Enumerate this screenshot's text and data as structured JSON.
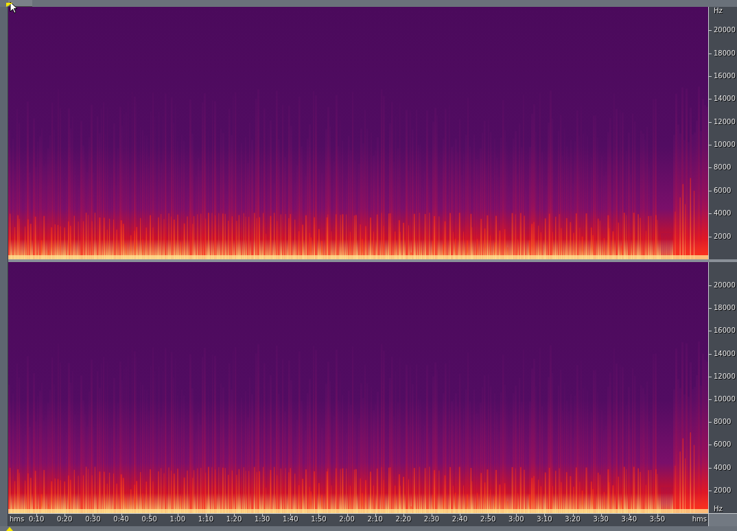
{
  "channels": [
    {
      "frequency_axis": {
        "top_unit": "Hz",
        "labels": [
          "20000",
          "18000",
          "16000",
          "14000",
          "12000",
          "10000",
          "8000",
          "6000",
          "4000",
          "2000"
        ]
      }
    },
    {
      "frequency_axis": {
        "labels": [
          "20000",
          "18000",
          "16000",
          "14000",
          "12000",
          "10000",
          "8000",
          "6000",
          "4000",
          "2000"
        ],
        "bottom_unit": "Hz"
      }
    }
  ],
  "time_ruler": {
    "start_label": "hms",
    "end_label": "hms",
    "ticks": [
      "0:10",
      "0:20",
      "0:30",
      "0:40",
      "0:50",
      "1:00",
      "1:10",
      "1:20",
      "1:30",
      "1:40",
      "1:50",
      "2:00",
      "2:10",
      "2:20",
      "2:30",
      "2:40",
      "2:50",
      "3:00",
      "3:10",
      "3:20",
      "3:30",
      "3:40",
      "3:50"
    ]
  }
}
